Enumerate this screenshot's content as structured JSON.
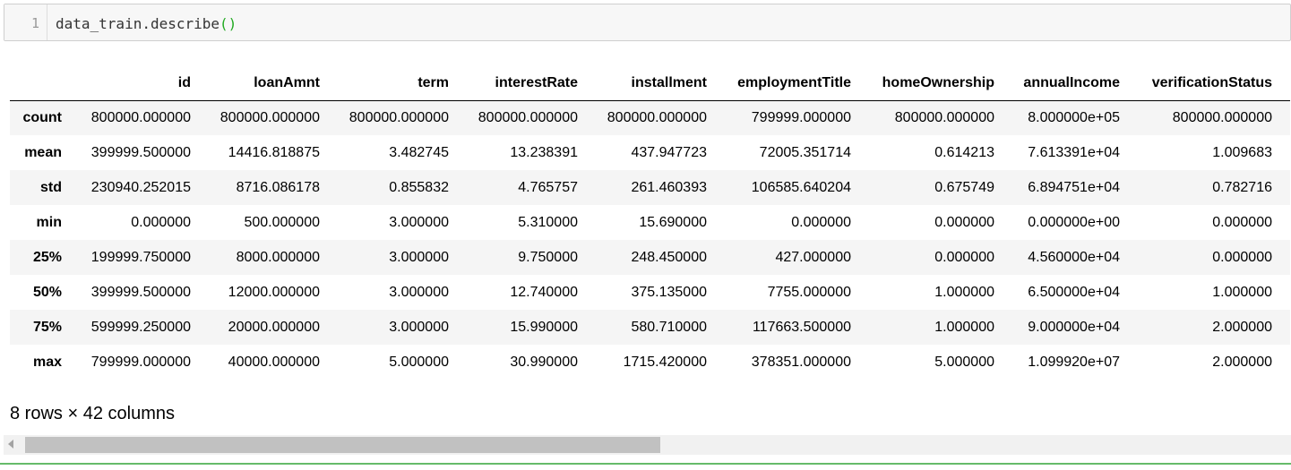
{
  "input_cell": {
    "line_number": "1",
    "code_text": "data_train.describe",
    "code_parens": "()"
  },
  "table": {
    "columns": [
      "id",
      "loanAmnt",
      "term",
      "interestRate",
      "installment",
      "employmentTitle",
      "homeOwnership",
      "annualIncome",
      "verificationStatus"
    ],
    "rows": [
      {
        "label": "count",
        "values": [
          "800000.000000",
          "800000.000000",
          "800000.000000",
          "800000.000000",
          "800000.000000",
          "799999.000000",
          "800000.000000",
          "8.000000e+05",
          "800000.000000"
        ]
      },
      {
        "label": "mean",
        "values": [
          "399999.500000",
          "14416.818875",
          "3.482745",
          "13.238391",
          "437.947723",
          "72005.351714",
          "0.614213",
          "7.613391e+04",
          "1.009683"
        ]
      },
      {
        "label": "std",
        "values": [
          "230940.252015",
          "8716.086178",
          "0.855832",
          "4.765757",
          "261.460393",
          "106585.640204",
          "0.675749",
          "6.894751e+04",
          "0.782716"
        ]
      },
      {
        "label": "min",
        "values": [
          "0.000000",
          "500.000000",
          "3.000000",
          "5.310000",
          "15.690000",
          "0.000000",
          "0.000000",
          "0.000000e+00",
          "0.000000"
        ]
      },
      {
        "label": "25%",
        "values": [
          "199999.750000",
          "8000.000000",
          "3.000000",
          "9.750000",
          "248.450000",
          "427.000000",
          "0.000000",
          "4.560000e+04",
          "0.000000"
        ]
      },
      {
        "label": "50%",
        "values": [
          "399999.500000",
          "12000.000000",
          "3.000000",
          "12.740000",
          "375.135000",
          "7755.000000",
          "1.000000",
          "6.500000e+04",
          "1.000000"
        ]
      },
      {
        "label": "75%",
        "values": [
          "599999.250000",
          "20000.000000",
          "3.000000",
          "15.990000",
          "580.710000",
          "117663.500000",
          "1.000000",
          "9.000000e+04",
          "2.000000"
        ]
      },
      {
        "label": "max",
        "values": [
          "799999.000000",
          "40000.000000",
          "5.000000",
          "30.990000",
          "1715.420000",
          "378351.000000",
          "5.000000",
          "1.099920e+07",
          "2.000000"
        ]
      }
    ]
  },
  "summary": "8 rows × 42 columns",
  "scrollbar": {
    "left_icon": "scroll-left-arrow-icon",
    "position": 0
  },
  "colors": {
    "cell_border_active": "#66bb6a",
    "paren_match": "#22aa22"
  }
}
